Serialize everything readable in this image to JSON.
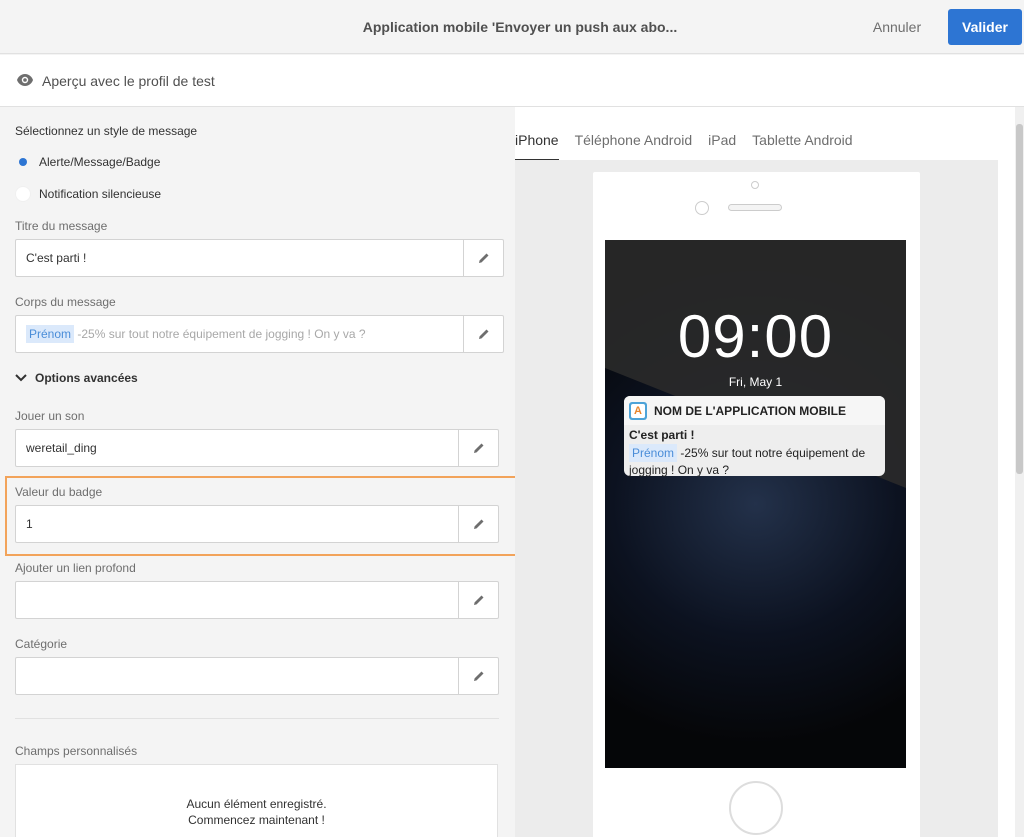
{
  "header": {
    "title": "Application mobile 'Envoyer un push aux abo...",
    "cancel_label": "Annuler",
    "validate_label": "Valider"
  },
  "preview_bar": {
    "label": "Aperçu avec le profil de test",
    "icon": "eye-icon"
  },
  "form": {
    "style_label": "Sélectionnez un style de message",
    "style_options": [
      {
        "label": "Alerte/Message/Badge",
        "selected": true
      },
      {
        "label": "Notification silencieuse",
        "selected": false
      }
    ],
    "title_label": "Titre du message",
    "title_value": "C'est parti !",
    "body_label": "Corps du message",
    "body_tag": "Prénom",
    "body_text": "-25% sur tout notre équipement de jogging ! On y va ?",
    "advanced_label": "Options avancées",
    "sound_label": "Jouer un son",
    "sound_value": "weretail_ding",
    "badge_label": "Valeur du badge",
    "badge_value": "1",
    "deeplink_label": "Ajouter un lien profond",
    "deeplink_value": "",
    "category_label": "Catégorie",
    "category_value": "",
    "custom_fields_label": "Champs personnalisés",
    "empty_line1": "Aucun élément enregistré.",
    "empty_line2": "Commencez maintenant !"
  },
  "preview": {
    "tabs": [
      {
        "label": "iPhone",
        "active": true
      },
      {
        "label": "Téléphone Android",
        "active": false
      },
      {
        "label": "iPad",
        "active": false
      },
      {
        "label": "Tablette Android",
        "active": false
      }
    ],
    "time": "09:00",
    "date": "Fri, May 1",
    "app_name": "NOM DE L'APPLICATION MOBILE",
    "app_icon_letter": "A",
    "notif_title": "C'est parti !",
    "notif_tag": "Prénom",
    "notif_text": "-25% sur tout notre équipement de jogging ! On y va ?"
  },
  "colors": {
    "accent": "#2d75d3",
    "highlight": "#f2a35a"
  }
}
